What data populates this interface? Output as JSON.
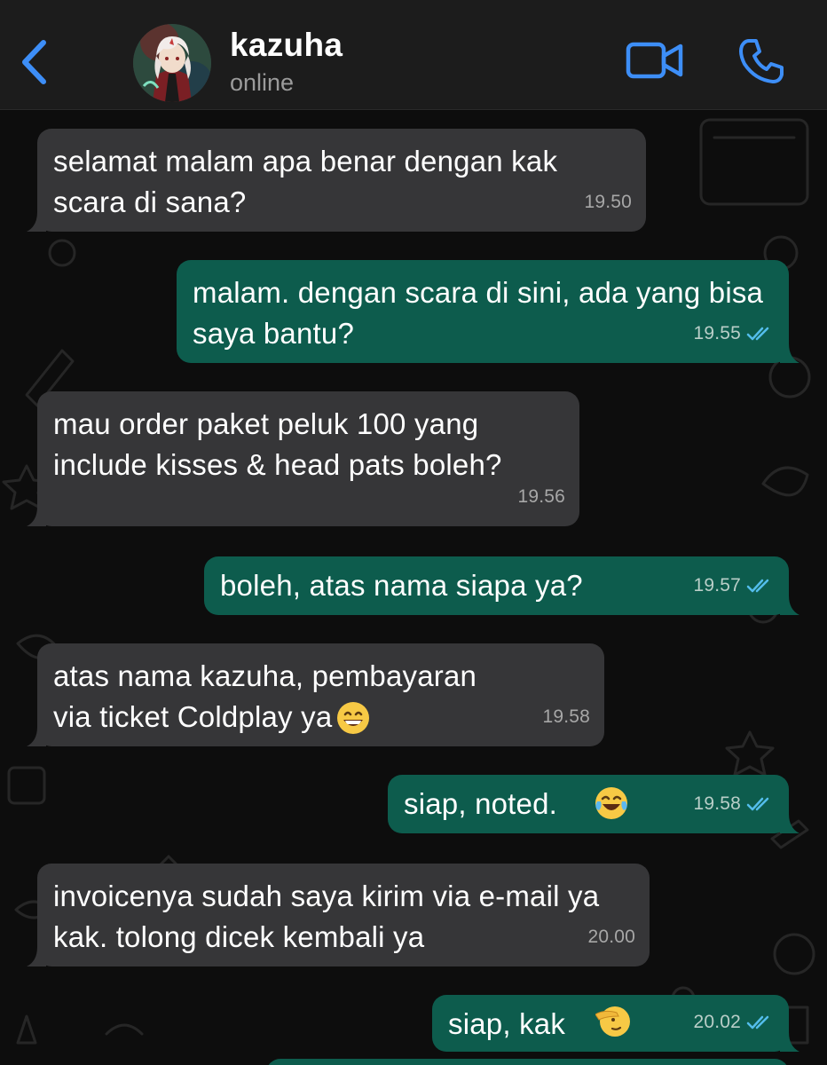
{
  "header": {
    "contact_name": "kazuha",
    "status": "online",
    "back_icon": "chevron-left-icon",
    "video_icon": "video-camera-icon",
    "call_icon": "phone-icon"
  },
  "colors": {
    "accent": "#3d8ef7",
    "incoming_bubble": "#363638",
    "outgoing_bubble": "#0d5c4d",
    "read_ticks": "#53bdeb"
  },
  "messages": [
    {
      "dir": "in",
      "text": "selamat malam apa benar dengan kak scara di sana?",
      "time": "19.50"
    },
    {
      "dir": "out",
      "text": "malam. dengan scara di sini, ada yang bisa saya bantu?",
      "time": "19.55",
      "status": "read"
    },
    {
      "dir": "in",
      "text": "mau order paket peluk 100 yang include kisses & head pats boleh?",
      "time": "19.56"
    },
    {
      "dir": "out",
      "text": "boleh, atas nama siapa ya?",
      "time": "19.57",
      "status": "read"
    },
    {
      "dir": "in",
      "text": "atas nama kazuha, pembayaran via ticket Coldplay ya",
      "emoji": "grinning-face",
      "time": "19.58"
    },
    {
      "dir": "out",
      "text": "siap, noted.",
      "emoji": "tears-of-joy-face",
      "time": "19.58",
      "status": "read"
    },
    {
      "dir": "in",
      "text": "invoicenya sudah saya kirim via e-mail ya kak. tolong dicek kembali ya",
      "time": "20.00"
    },
    {
      "dir": "out",
      "text": "siap, kak",
      "emoji": "saluting-face",
      "time": "20.02",
      "status": "read"
    }
  ]
}
